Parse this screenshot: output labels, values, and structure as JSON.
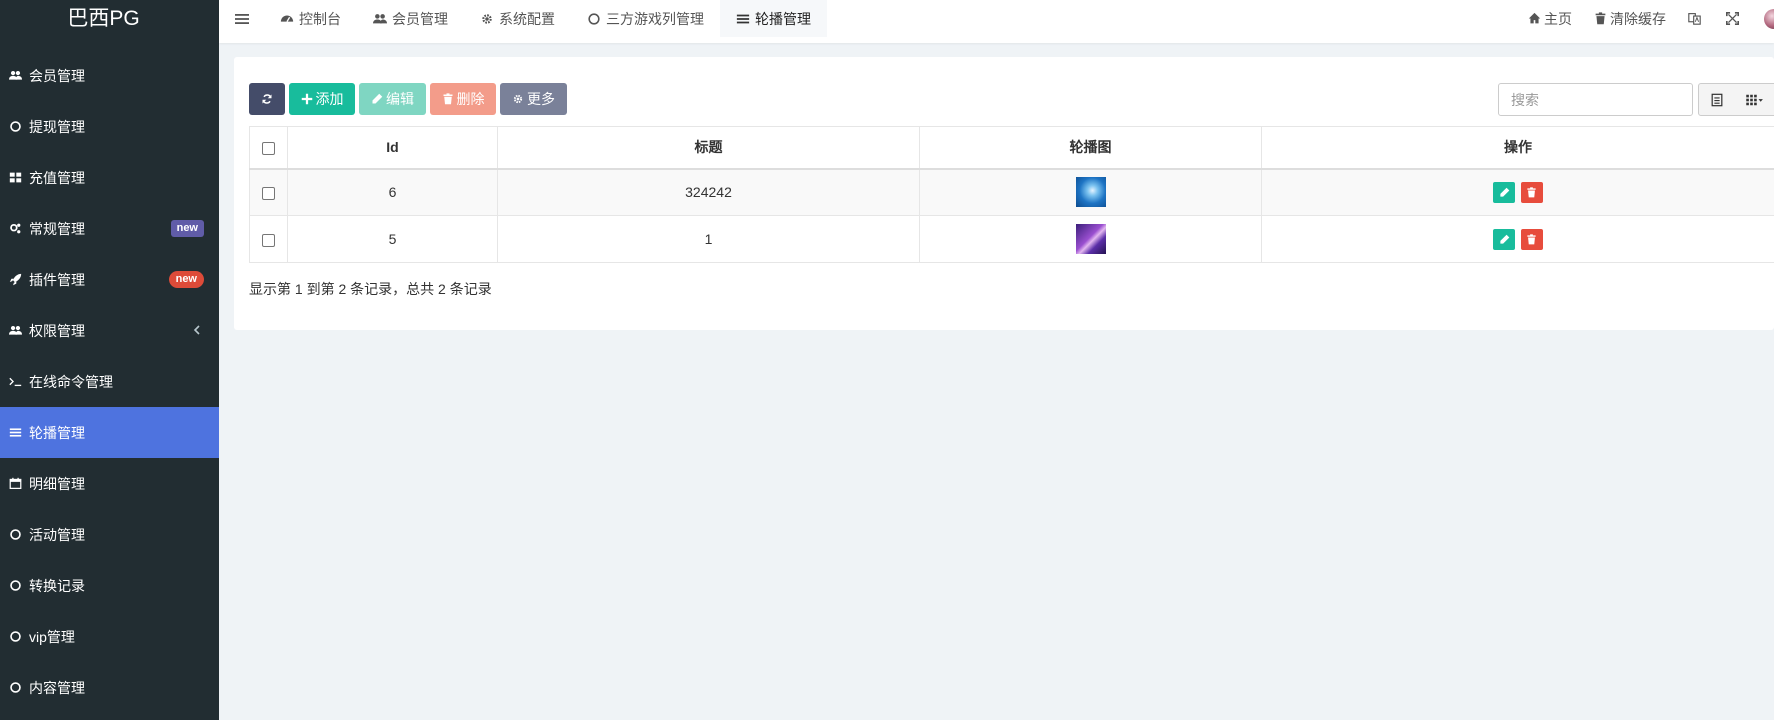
{
  "app": {
    "logo": "巴西PG"
  },
  "sidebar": {
    "items": [
      {
        "label": "会员管理",
        "icon": "users-icon"
      },
      {
        "label": "提现管理",
        "icon": "circle-icon"
      },
      {
        "label": "充值管理",
        "icon": "grid-icon"
      },
      {
        "label": "常规管理",
        "icon": "cogs-icon",
        "badge": "new"
      },
      {
        "label": "插件管理",
        "icon": "rocket-icon",
        "badge": "new"
      },
      {
        "label": "权限管理",
        "icon": "users-icon"
      },
      {
        "label": "在线命令管理",
        "icon": "terminal-icon"
      },
      {
        "label": "轮播管理",
        "icon": "list-icon",
        "active": true
      },
      {
        "label": "明细管理",
        "icon": "calendar-icon"
      },
      {
        "label": "活动管理",
        "icon": "circle-icon"
      },
      {
        "label": "转换记录",
        "icon": "circle-icon"
      },
      {
        "label": "vip管理",
        "icon": "circle-icon"
      },
      {
        "label": "内容管理",
        "icon": "circle-icon"
      }
    ]
  },
  "tabs": [
    {
      "label": "控制台",
      "icon": "dashboard-icon"
    },
    {
      "label": "会员管理",
      "icon": "users-icon"
    },
    {
      "label": "系统配置",
      "icon": "gear-icon"
    },
    {
      "label": "三方游戏列管理",
      "icon": "circle-icon"
    },
    {
      "label": "轮播管理",
      "icon": "list-icon",
      "active": true
    }
  ],
  "topright": {
    "home": "主页",
    "clear_cache": "清除缓存"
  },
  "toolbar": {
    "add": "添加",
    "edit": "编辑",
    "delete": "删除",
    "more": "更多"
  },
  "search": {
    "placeholder": "搜索"
  },
  "table": {
    "columns": [
      "Id",
      "标题",
      "轮播图",
      "操作"
    ],
    "rows": [
      {
        "id": "6",
        "title": "324242",
        "image": "blue"
      },
      {
        "id": "5",
        "title": "1",
        "image": "purple"
      }
    ]
  },
  "pagination": {
    "info": "显示第 1 到第 2 条记录，总共 2 条记录"
  },
  "colors": {
    "sidebar_bg": "#222d32",
    "active_item": "#4e73df",
    "green": "#18bc9c",
    "red": "#e74c3c"
  }
}
